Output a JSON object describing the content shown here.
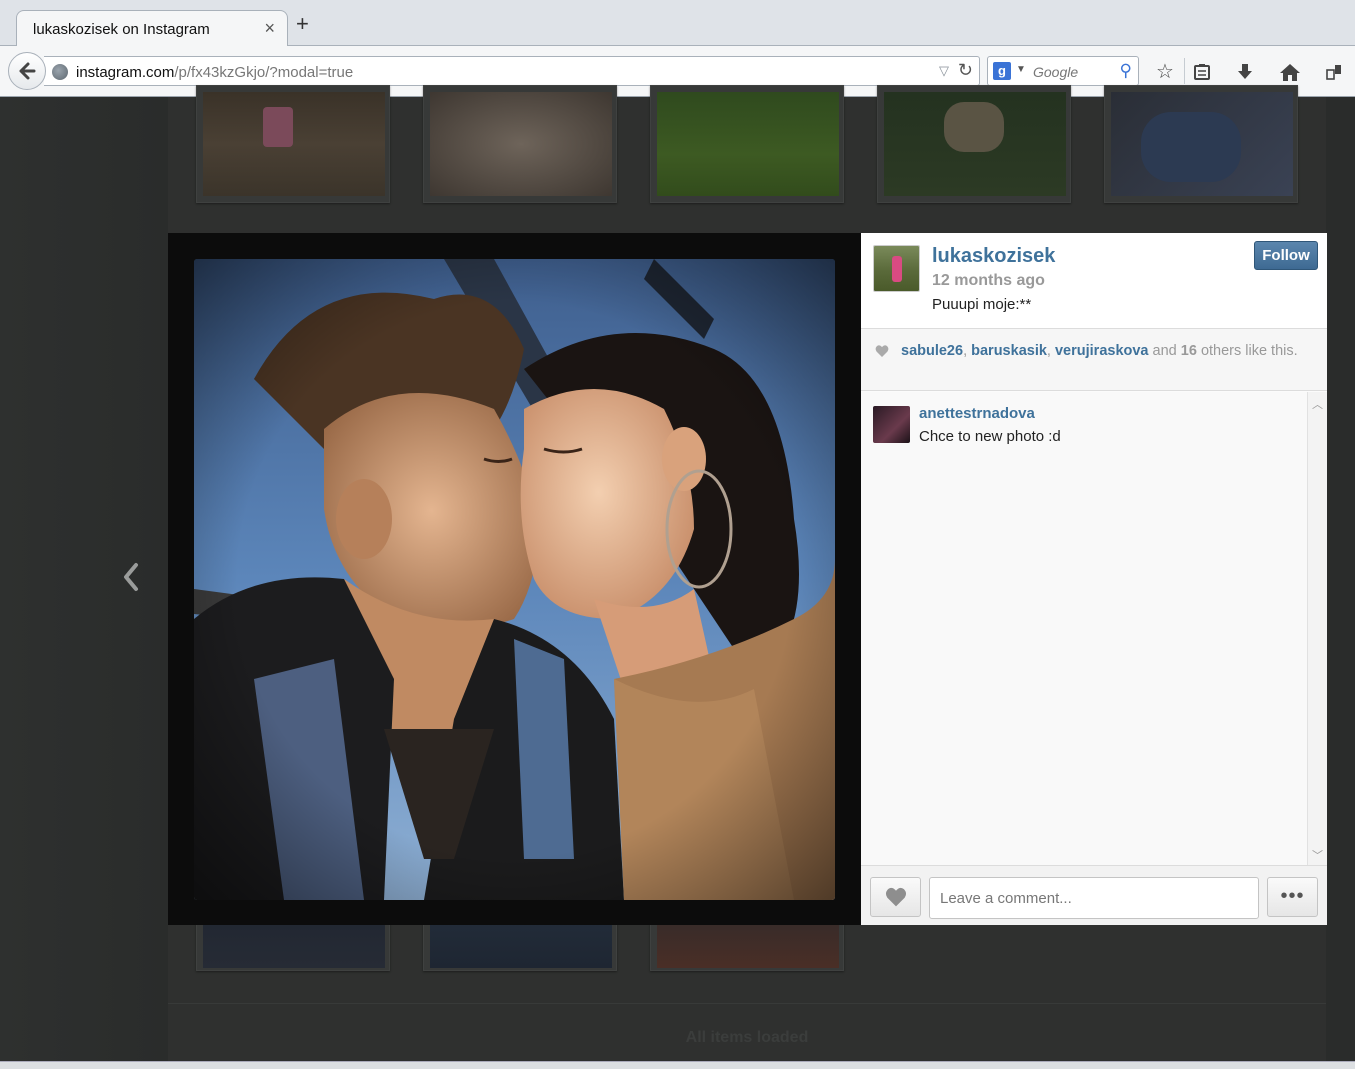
{
  "browser": {
    "tab_title": "lukaskozisek on Instagram",
    "tab_close": "×",
    "new_tab": "+",
    "url_host": "instagram.com",
    "url_path": "/p/fx43kzGkjo/?modal=true",
    "search_placeholder": "Google",
    "search_engine_icon": "g-icon"
  },
  "modal": {
    "owner": {
      "username": "lukaskozisek",
      "time_ago": "12 months ago",
      "caption": "Puuupi moje:**"
    },
    "follow_label": "Follow",
    "likes": {
      "users": [
        "sabule26",
        "baruskasik",
        "verujiraskova"
      ],
      "and_word": "and",
      "others_count": "16",
      "suffix": "others like this."
    },
    "comments": [
      {
        "username": "anettestrnadova",
        "text": "Chce to new photo :d"
      }
    ],
    "comment_placeholder": "Leave a comment...",
    "more_label": "•••"
  },
  "page": {
    "footer_text": "All items loaded"
  },
  "colors": {
    "link_blue": "#3f729b",
    "follow_bg": "#4a76a0",
    "backdrop": "#2f302f"
  }
}
